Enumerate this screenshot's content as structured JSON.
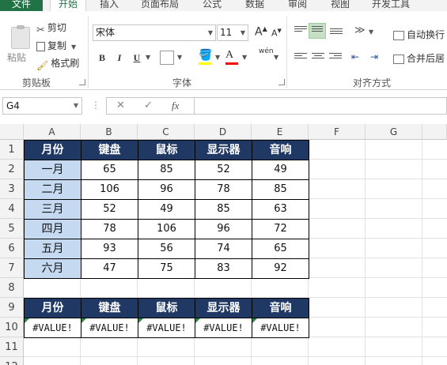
{
  "ribbon_tabs": [
    "文件",
    "开始",
    "插入",
    "页面布局",
    "公式",
    "数据",
    "审阅",
    "视图",
    "开发工具"
  ],
  "clipboard": {
    "paste_label": "粘贴",
    "cut_label": "剪切",
    "copy_label": "复制",
    "format_painter_label": "格式刷",
    "group_label": "剪贴板"
  },
  "font": {
    "font_name": "宋体",
    "font_size": "11",
    "bold": "B",
    "italic": "I",
    "underline": "U",
    "grow": "A",
    "shrink": "A",
    "phonetic": "wén",
    "group_label": "字体",
    "fill_color": "#ffff00",
    "font_color": "#ff0000"
  },
  "alignment": {
    "wrap_label": "自动换行",
    "merge_label": "合并后居",
    "group_label": "对齐方式"
  },
  "formula_bar": {
    "name_box": "G4",
    "formula": ""
  },
  "sheet": {
    "columns": [
      "A",
      "B",
      "C",
      "D",
      "E",
      "F",
      "G"
    ],
    "rows": [
      "1",
      "2",
      "3",
      "4",
      "5",
      "6",
      "7",
      "8",
      "9",
      "10",
      "11",
      "12"
    ],
    "header_fill": "#203864",
    "month_fill": "#c5d9f1",
    "table1_headers": [
      "月份",
      "键盘",
      "鼠标",
      "显示器",
      "音响"
    ],
    "table1_rows": [
      [
        "一月",
        "65",
        "85",
        "52",
        "49"
      ],
      [
        "二月",
        "106",
        "96",
        "78",
        "85"
      ],
      [
        "三月",
        "52",
        "49",
        "85",
        "63"
      ],
      [
        "四月",
        "78",
        "106",
        "96",
        "72"
      ],
      [
        "五月",
        "93",
        "56",
        "74",
        "65"
      ],
      [
        "六月",
        "47",
        "75",
        "83",
        "92"
      ]
    ],
    "table2_headers": [
      "月份",
      "键盘",
      "鼠标",
      "显示器",
      "音响"
    ],
    "table2_values": [
      "#VALUE!",
      "#VALUE!",
      "#VALUE!",
      "#VALUE!",
      "#VALUE!"
    ]
  }
}
